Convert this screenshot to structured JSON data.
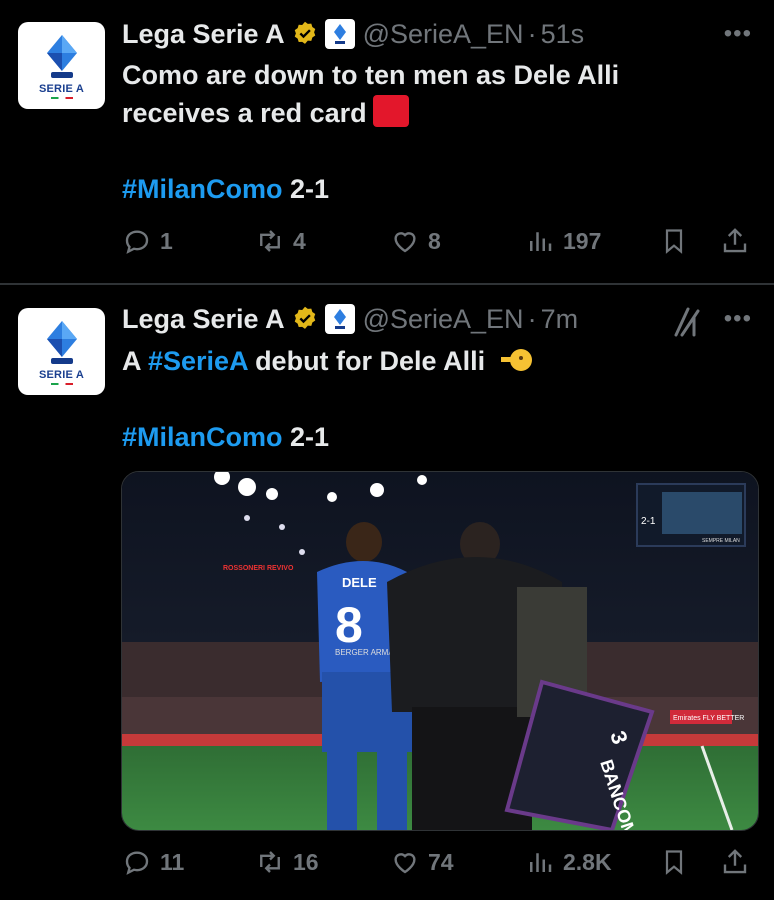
{
  "tweets": [
    {
      "author": {
        "name": "Lega Serie A",
        "handle": "@SerieA_EN",
        "time": "51s",
        "logo_text": "SERIE A"
      },
      "text_line1": "Como are down to ten men as Dele Alli",
      "text_line2": "receives a red card",
      "hashtag": "#MilanComo",
      "score": " 2-1",
      "stats": {
        "replies": "1",
        "reposts": "4",
        "likes": "8",
        "views": "197"
      }
    },
    {
      "author": {
        "name": "Lega Serie A",
        "handle": "@SerieA_EN",
        "time": "7m",
        "logo_text": "SERIE A"
      },
      "text_prefix": "A ",
      "text_hashtag": "#SerieA",
      "text_suffix": " debut for Dele Alli",
      "hashtag": "#MilanComo",
      "score": " 2-1",
      "media": {
        "shirt_name": "DELE",
        "shirt_number": "8",
        "sponsor": "BERGER ARMAN",
        "board_text": "BANCOMAT",
        "board_number": "3",
        "screen_score": "2-1",
        "screen_text": "SEMPRE MILAN",
        "ad_text": "Emirates FLY BETTER",
        "stadium_text": "ROSSONERI REVIVO"
      },
      "stats": {
        "replies": "11",
        "reposts": "16",
        "likes": "74",
        "views": "2.8K"
      }
    }
  ],
  "colors": {
    "background": "#000000",
    "text": "#e7e9ea",
    "muted": "#71767b",
    "link": "#1d9bf0",
    "verified": "#e2b719"
  },
  "icons": [
    "reply-icon",
    "repost-icon",
    "like-icon",
    "views-icon",
    "bookmark-icon",
    "share-icon",
    "more-icon",
    "verified-icon",
    "grok-icon"
  ]
}
